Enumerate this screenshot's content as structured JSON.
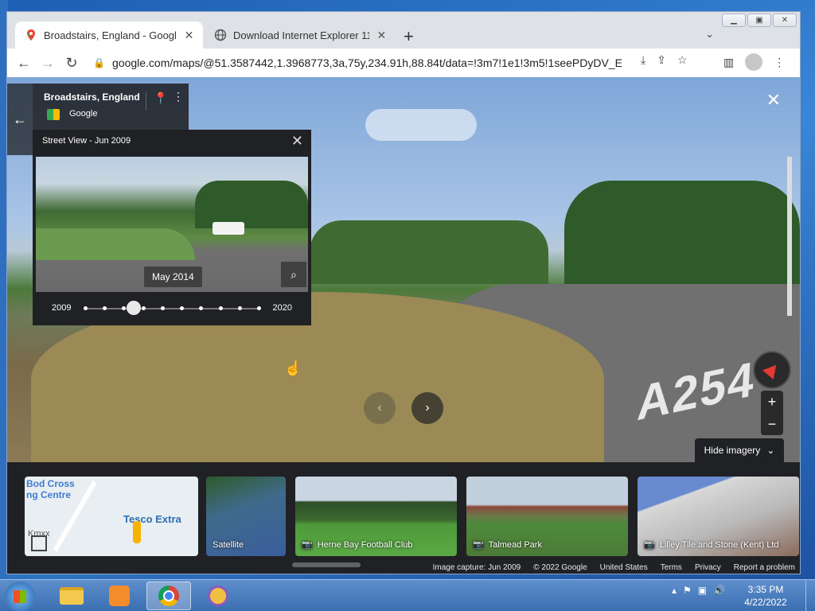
{
  "browser": {
    "tabs": [
      {
        "label": "Broadstairs, England - Google Maps",
        "active": true
      },
      {
        "label": "Download Internet Explorer 11 for Windows 7",
        "active": false
      }
    ],
    "url": "google.com/maps/@51.3587442,1.3968773,3a,75y,234.91h,88.84t/data=!3m7!1e1!3m5!1seePDyDV_En..."
  },
  "place_card": {
    "name": "Broadstairs, England",
    "source": "Google"
  },
  "time_machine": {
    "header": "Street View - Jun 2009",
    "selected_date": "May 2014",
    "year_start": "2009",
    "year_end": "2020",
    "slider_position_index": 1,
    "slider_stops": 10
  },
  "road_marking": "A254",
  "controls": {
    "hide_imagery": "Hide imagery"
  },
  "imagery_strip": {
    "map_card": {
      "label_1": "Bod Cross",
      "label_2": "ng Centre",
      "label_3": "Tesco Extra",
      "label_4": "Kmxx"
    },
    "cards": [
      {
        "label": "Satellite",
        "type": "satellite"
      },
      {
        "label": "Herne Bay Football Club",
        "type": "photo"
      },
      {
        "label": "Talmead Park",
        "type": "photo"
      },
      {
        "label": "Lilley Tile and Stone (Kent) Ltd",
        "type": "photo"
      }
    ]
  },
  "footer": {
    "capture": "Image capture: Jun 2009",
    "copyright": "© 2022 Google",
    "region": "United States",
    "terms": "Terms",
    "privacy": "Privacy",
    "report": "Report a problem"
  },
  "taskbar": {
    "time": "3:35 PM",
    "date": "4/22/2022"
  }
}
